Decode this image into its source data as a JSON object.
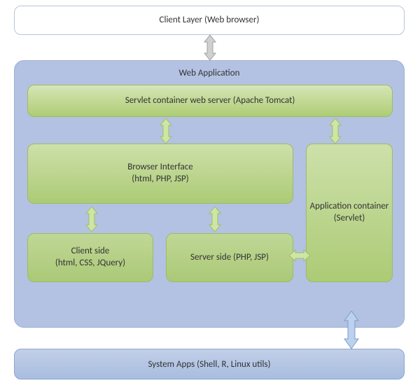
{
  "diagram": {
    "client_layer": "Client Layer (Web browser)",
    "webapp_title": "Web Application",
    "servlet_container": "Servlet container web server (Apache Tomcat)",
    "browser_interface_line1": "Browser Interface",
    "browser_interface_line2": "(html, PHP, JSP)",
    "client_side_line1": "Client side",
    "client_side_line2": "(html, CSS, JQuery)",
    "server_side": "Server side (PHP, JSP)",
    "app_container_line1": "Application container",
    "app_container_line2": "(Servlet)",
    "system_apps": "System Apps (Shell, R, Linux utils)"
  },
  "colors": {
    "gray_arrow_fill": "#d0d0d0",
    "gray_arrow_stroke": "#a0a0a0",
    "green_arrow_fill": "#cfe5a5",
    "green_arrow_stroke": "#9fbf62",
    "blue_arrow_fill": "#bcd1ef",
    "blue_arrow_stroke": "#7d9cc9"
  }
}
